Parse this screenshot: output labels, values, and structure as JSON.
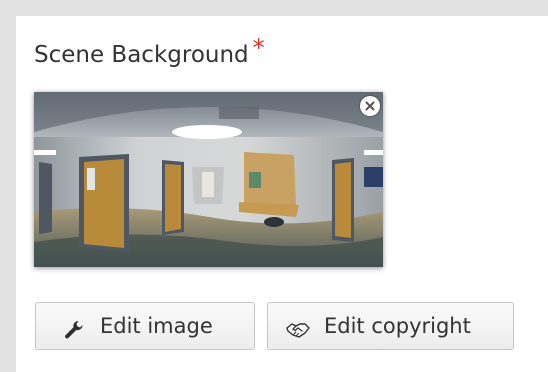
{
  "field": {
    "label": "Scene Background",
    "required_mark": "*"
  },
  "image": {
    "icons": {
      "remove": "close-icon"
    }
  },
  "buttons": {
    "edit_image": {
      "label": "Edit image",
      "icon": "wrench-icon"
    },
    "edit_copyright": {
      "label": "Edit copyright",
      "icon": "handshake-icon"
    }
  },
  "colors": {
    "required": "#d9352a",
    "text": "#333333",
    "border": "#c5c5c5"
  }
}
